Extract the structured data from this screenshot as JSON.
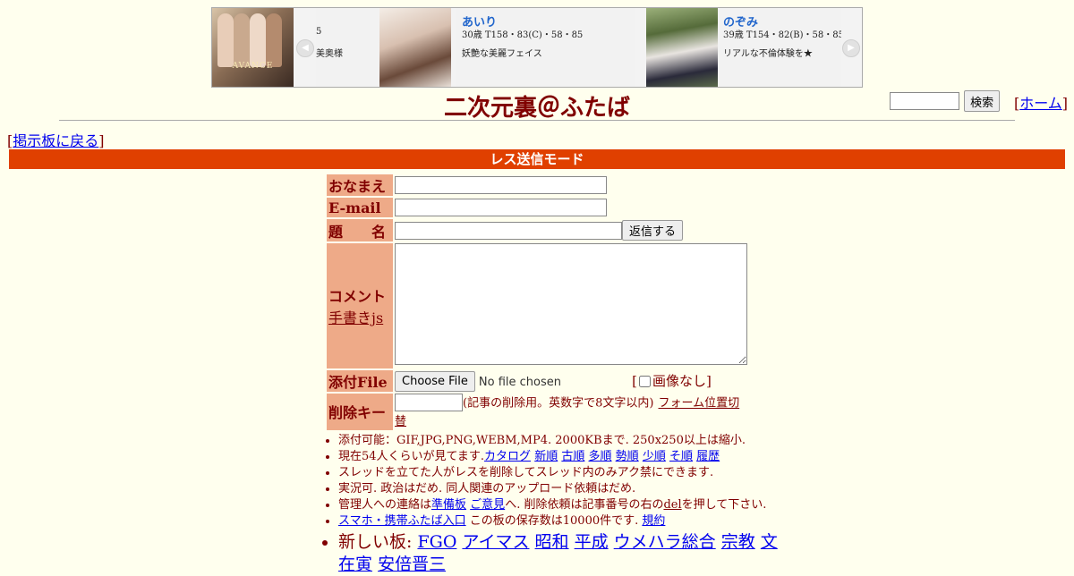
{
  "banner": {
    "logo_text": "AVANCE",
    "left_fragment": {
      "spec": "5",
      "desc": "美奥様"
    },
    "cards": [
      {
        "name": "あいり",
        "spec": "30歳 T158・83(C)・58・85",
        "desc": "妖艶な美麗フェイス"
      },
      {
        "name": "のぞみ",
        "spec": "39歳 T154・82(B)・58・85",
        "desc": "リアルな不倫体験を★"
      }
    ]
  },
  "page_title": "二次元裏＠ふたば",
  "search": {
    "button_label": "検索"
  },
  "home": {
    "open": "[",
    "label": "ホーム",
    "close": "]"
  },
  "back": {
    "open": "[",
    "label": "掲示板に戻る",
    "close": "]"
  },
  "mode_bar": "レス送信モード",
  "form": {
    "name_label": "おなまえ",
    "email_label": "E-mail",
    "subject_label": "題　　名",
    "submit_label": "返信する",
    "comment_label": "コメント",
    "tegaki_link": "手書きjs",
    "file_label": "添付File",
    "choose_file_label": "Choose File",
    "no_file_text": "No file chosen",
    "no_image_open": "[",
    "no_image_label": "画像なし",
    "no_image_close": "]",
    "delkey_label": "削除キー",
    "delkey_note": "(記事の削除用。英数字で8文字以内)",
    "form_toggle_link": "フォーム位置切替"
  },
  "notes": {
    "line1": "添付可能：GIF,JPG,PNG,WEBM,MP4. 2000KBまで. 250x250以上は縮小.",
    "line2_prefix": "現在54人くらいが見てます.",
    "line2_links": [
      "カタログ",
      "新順",
      "古順",
      "多順",
      "勢順",
      "少順",
      "そ順",
      "履歴"
    ],
    "line3": "スレッドを立てた人がレスを削除してスレッド内のみアク禁にできます.",
    "line4": "実況可. 政治はだめ. 同人関連のアップロード依頼はだめ.",
    "line5_a": "管理人への連絡は",
    "line5_link1": "準備板",
    "line5_b": "",
    "line5_link2": "ご意見",
    "line5_c": "へ. 削除依頼は記事番号の右の",
    "line5_link3": "del",
    "line5_d": "を押して下さい.",
    "line6_link1": "スマホ・携帯ふたば入口",
    "line6_text": " この板の保存数は10000件です.",
    "line6_link2": "規約",
    "boards_label": "新しい板: ",
    "boards": [
      "FGO",
      "アイマス",
      "昭和",
      "平成",
      "ウメハラ総合",
      "宗教",
      "文在寅",
      "安倍晋三"
    ]
  }
}
